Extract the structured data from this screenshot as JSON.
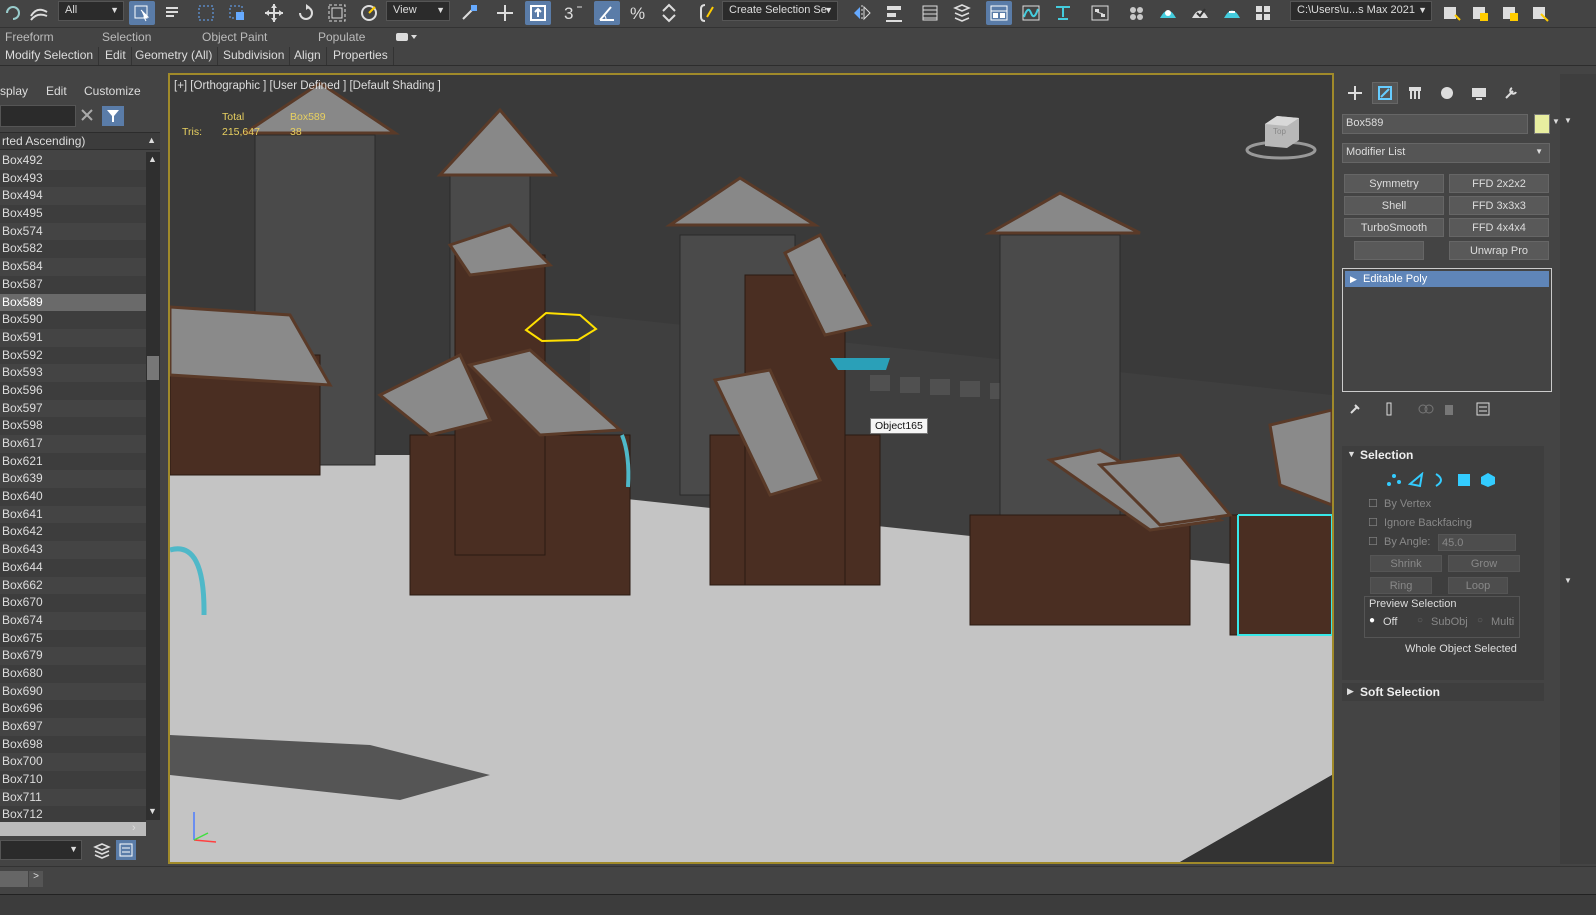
{
  "toolbar": {
    "selection_filter": "All",
    "ref_coord": "View",
    "named_selection": "Create Selection Se",
    "project_path": "C:\\Users\\u...s Max 2021",
    "icons": [
      "undo-icon",
      "link-icon",
      "select-object-icon",
      "select-by-name-icon",
      "rect-region-icon",
      "window-crossing-icon",
      "move-icon",
      "rotate-icon",
      "scale-icon",
      "placement-icon",
      "pivot-icon",
      "select-manipulate-icon",
      "keyboard-shortcut-icon",
      "snap-3d-icon",
      "angle-snap-icon",
      "percent-snap-icon",
      "spinner-snap-icon",
      "edit-named-sets-icon",
      "mirror-icon",
      "align-icon",
      "layer-explorer-icon",
      "toggle-ribbon-icon",
      "curve-editor-icon",
      "schematic-view-icon",
      "material-editor-icon",
      "render-setup-icon",
      "render-frame-icon",
      "render-icon"
    ]
  },
  "ribbon": {
    "tabs": [
      "Freeform",
      "Selection",
      "Object Paint",
      "Populate"
    ],
    "panels": [
      "Modify Selection",
      "Edit",
      "Geometry (All)",
      "Subdivision",
      "Align",
      "Properties"
    ]
  },
  "explorer": {
    "menu": [
      "splay",
      "Edit",
      "Customize"
    ],
    "sort_header": "rted Ascending)",
    "items": [
      "Box492",
      "Box493",
      "Box494",
      "Box495",
      "Box574",
      "Box582",
      "Box584",
      "Box587",
      "Box589",
      "Box590",
      "Box591",
      "Box592",
      "Box593",
      "Box596",
      "Box597",
      "Box598",
      "Box617",
      "Box621",
      "Box639",
      "Box640",
      "Box641",
      "Box642",
      "Box643",
      "Box644",
      "Box662",
      "Box670",
      "Box674",
      "Box675",
      "Box679",
      "Box680",
      "Box690",
      "Box696",
      "Box697",
      "Box698",
      "Box700",
      "Box710",
      "Box711",
      "Box712"
    ],
    "selected": "Box589"
  },
  "viewport": {
    "label": "[+] [Orthographic ] [User Defined ] [Default Shading ]",
    "stats": {
      "total_label": "Total",
      "selected_name": "Box589",
      "tris_label": "Tris:",
      "tris_total": "215,647",
      "tris_selected": "38"
    },
    "tooltip": "Object165",
    "viewcube_label": "Top"
  },
  "command_panel": {
    "object_name": "Box589",
    "object_color": "#e8eea0",
    "modifier_list": "Modifier List",
    "modifier_buttons": [
      "Symmetry",
      "FFD 2x2x2",
      "Shell",
      "FFD 3x3x3",
      "TurboSmooth",
      "FFD 4x4x4",
      "",
      "Unwrap Pro"
    ],
    "stack_item": "Editable Poly",
    "selection_rollout": {
      "title": "Selection",
      "by_vertex": "By Vertex",
      "ignore_backfacing": "Ignore Backfacing",
      "by_angle": "By Angle:",
      "by_angle_value": "45.0",
      "shrink": "Shrink",
      "grow": "Grow",
      "ring": "Ring",
      "loop": "Loop",
      "preview_selection": "Preview Selection",
      "preview_off": "Off",
      "preview_subobj": "SubObj",
      "preview_multi": "Multi",
      "status": "Whole Object Selected"
    },
    "soft_selection": "Soft Selection"
  }
}
